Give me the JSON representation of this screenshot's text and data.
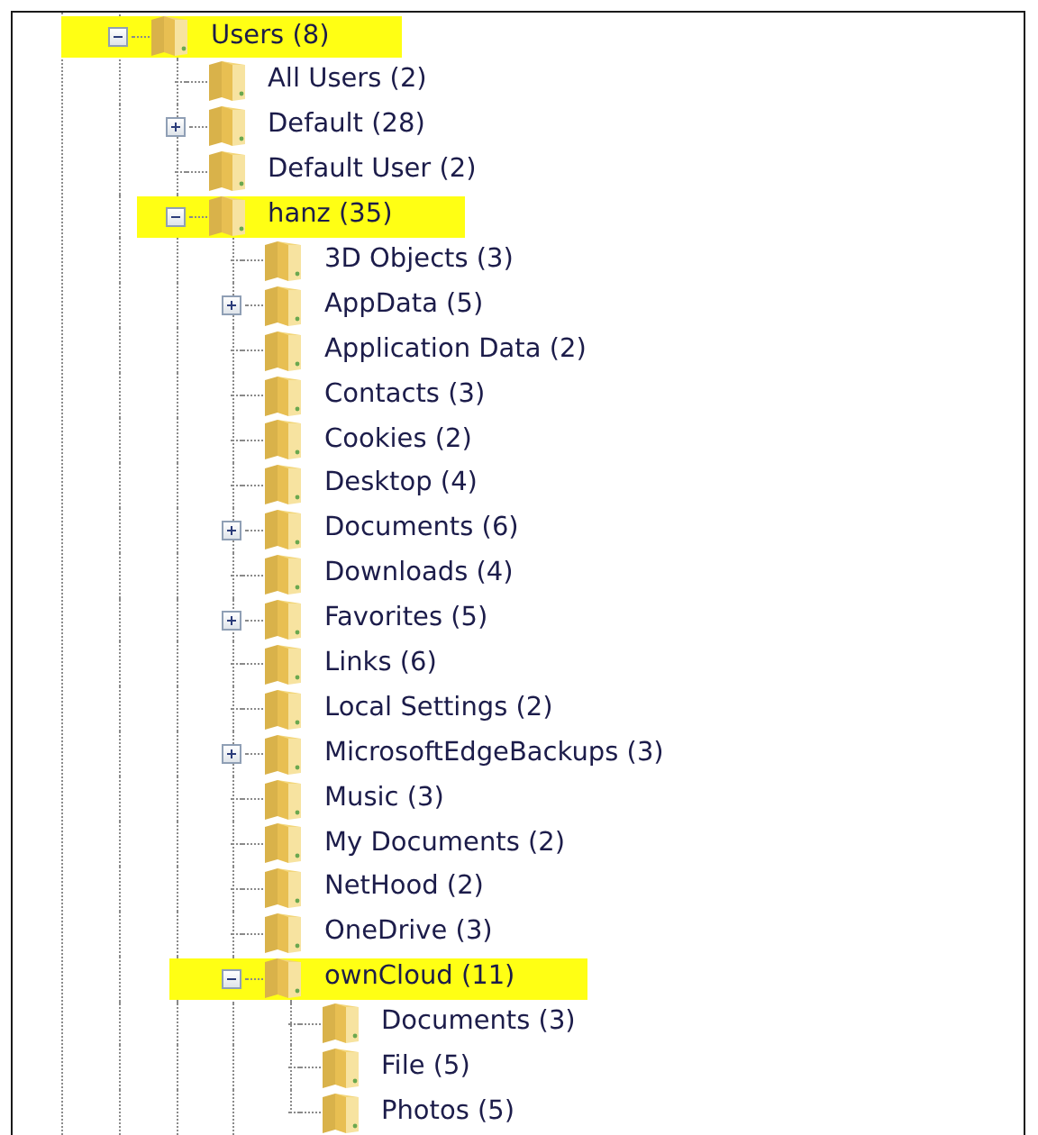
{
  "tree": [
    {
      "label": "Users (8)",
      "expanded": true,
      "highlighted": true,
      "children": [
        {
          "label": "All Users (2)",
          "highlighted": false
        },
        {
          "label": "Default (28)",
          "expanded": false,
          "highlighted": false
        },
        {
          "label": "Default User (2)",
          "highlighted": false
        },
        {
          "label": "hanz (35)",
          "expanded": true,
          "highlighted": true,
          "children": [
            {
              "label": "3D Objects (3)",
              "highlighted": false
            },
            {
              "label": "AppData (5)",
              "expanded": false,
              "highlighted": false
            },
            {
              "label": "Application Data (2)",
              "highlighted": false
            },
            {
              "label": "Contacts (3)",
              "highlighted": false
            },
            {
              "label": "Cookies (2)",
              "highlighted": false
            },
            {
              "label": "Desktop (4)",
              "highlighted": false
            },
            {
              "label": "Documents (6)",
              "expanded": false,
              "highlighted": false
            },
            {
              "label": "Downloads (4)",
              "highlighted": false
            },
            {
              "label": "Favorites (5)",
              "expanded": false,
              "highlighted": false
            },
            {
              "label": "Links (6)",
              "highlighted": false
            },
            {
              "label": "Local Settings (2)",
              "highlighted": false
            },
            {
              "label": "MicrosoftEdgeBackups (3)",
              "expanded": false,
              "highlighted": false
            },
            {
              "label": "Music (3)",
              "highlighted": false
            },
            {
              "label": "My Documents (2)",
              "highlighted": false
            },
            {
              "label": "NetHood (2)",
              "highlighted": false
            },
            {
              "label": "OneDrive (3)",
              "highlighted": false
            },
            {
              "label": "ownCloud (11)",
              "expanded": true,
              "highlighted": true,
              "children": [
                {
                  "label": "Documents (3)",
                  "highlighted": false
                },
                {
                  "label": "File (5)",
                  "highlighted": false
                },
                {
                  "label": "Photos (5)",
                  "highlighted": false
                }
              ]
            }
          ]
        }
      ]
    }
  ]
}
